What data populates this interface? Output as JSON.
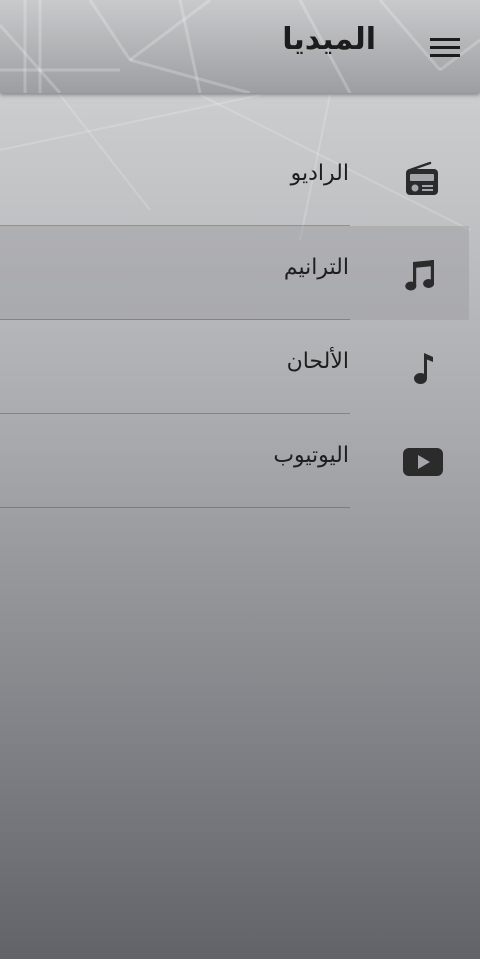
{
  "app_bar": {
    "title": "الميديا",
    "menu_icon": "hamburger-menu-icon"
  },
  "menu": {
    "selected_index": 1,
    "items": [
      {
        "label": "الراديو",
        "icon": "radio-icon"
      },
      {
        "label": "الترانيم",
        "icon": "music-notes-icon"
      },
      {
        "label": "الألحان",
        "icon": "music-note-icon"
      },
      {
        "label": "اليوتيوب",
        "icon": "youtube-icon"
      }
    ]
  },
  "colors": {
    "icon": "#2b2b2b",
    "text": "#1e1e1e",
    "title": "#1c1c1c"
  }
}
